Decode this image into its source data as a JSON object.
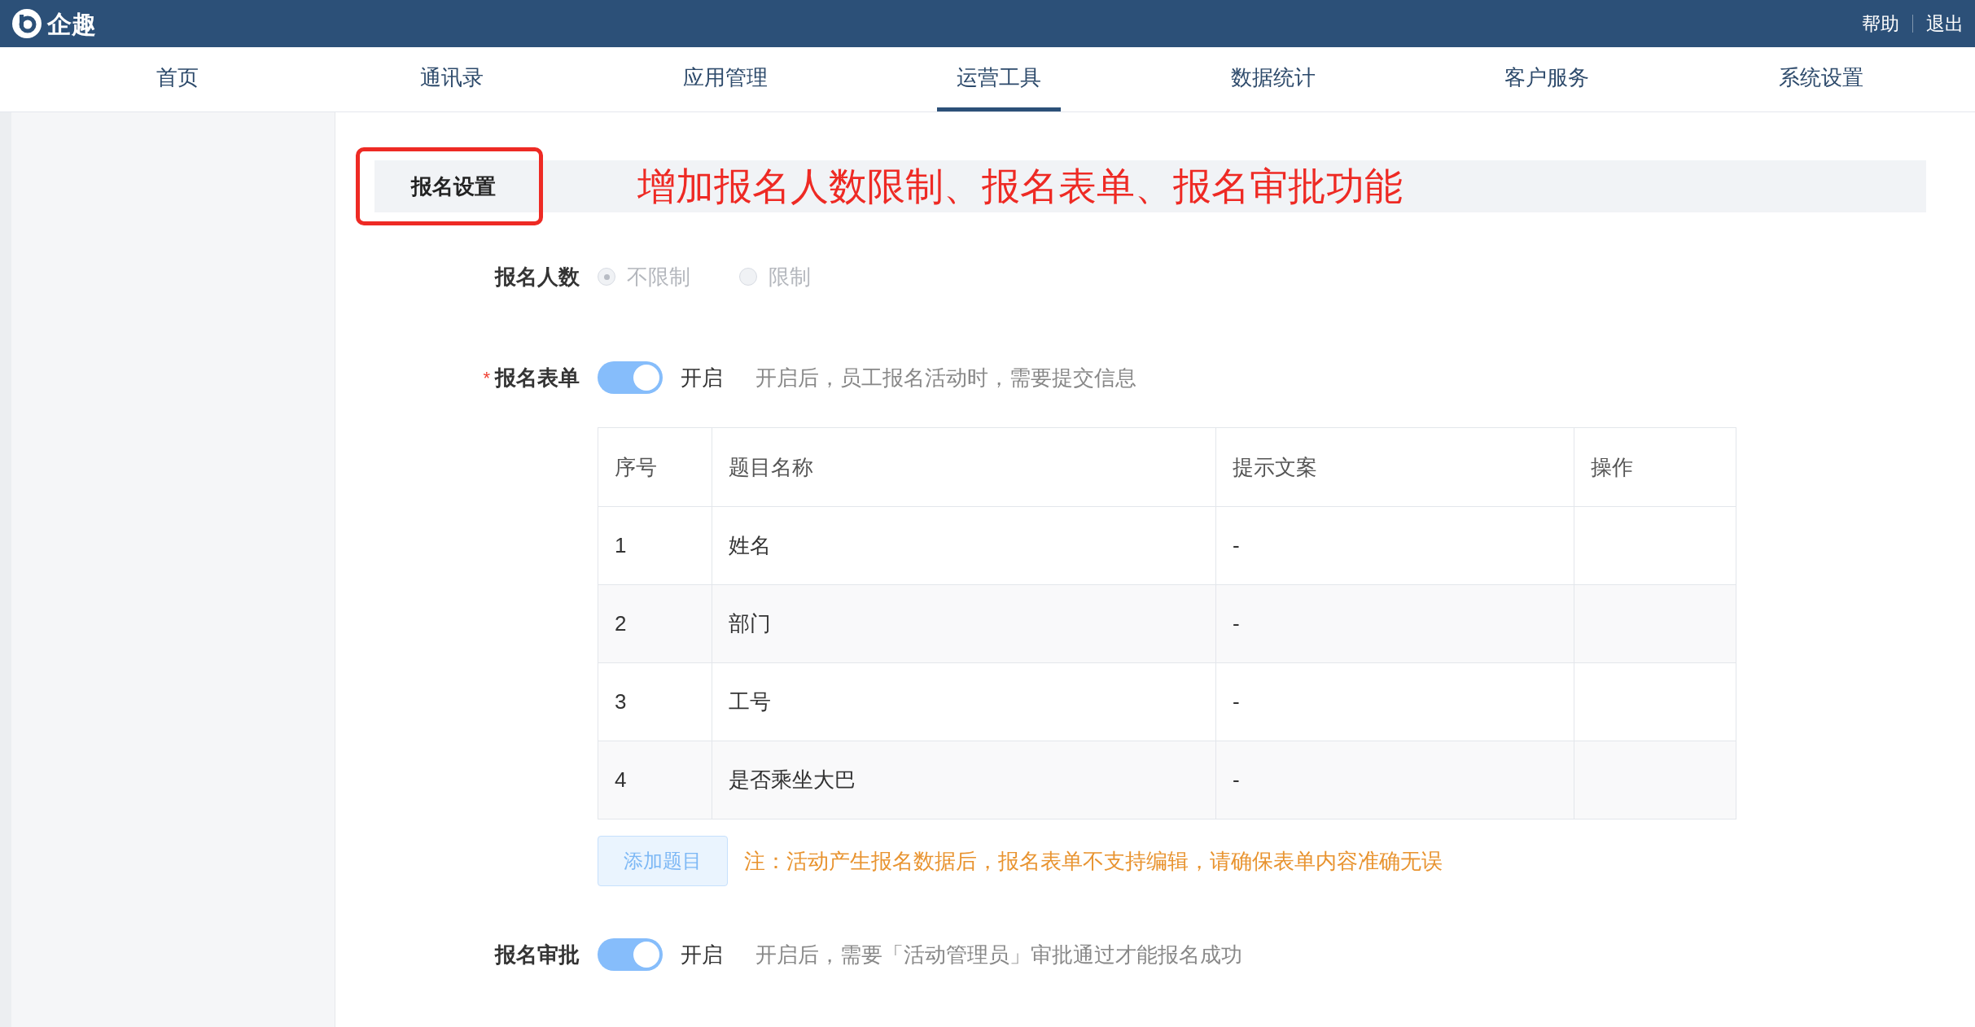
{
  "app": {
    "name": "企趣"
  },
  "header_links": [
    "帮助",
    "退出"
  ],
  "nav_tabs": [
    {
      "label": "首页",
      "selected": false
    },
    {
      "label": "通讯录",
      "selected": false
    },
    {
      "label": "应用管理",
      "selected": false
    },
    {
      "label": "运营工具",
      "selected": true
    },
    {
      "label": "数据统计",
      "selected": false
    },
    {
      "label": "客户服务",
      "selected": false
    },
    {
      "label": "系统设置",
      "selected": false
    }
  ],
  "section": {
    "title": "报名设置",
    "annotation": "增加报名人数限制、报名表单、报名审批功能"
  },
  "signup_limit": {
    "label": "报名人数",
    "disabled": true,
    "options": [
      {
        "label": "不限制",
        "selected": true
      },
      {
        "label": "限制",
        "selected": false
      }
    ]
  },
  "signup_form": {
    "label": "报名表单",
    "required_mark": "*",
    "toggle": {
      "on": true,
      "label": "开启"
    },
    "hint": "开启后，员工报名活动时，需要提交信息",
    "table": {
      "columns": [
        "序号",
        "题目名称",
        "提示文案",
        "操作"
      ],
      "rows": [
        [
          "1",
          "姓名",
          "-"
        ],
        [
          "2",
          "部门",
          "-"
        ],
        [
          "3",
          "工号",
          "-"
        ],
        [
          "4",
          "是否乘坐大巴",
          "-"
        ]
      ]
    },
    "add_button": "添加题目",
    "note": "注：活动产生报名数据后，报名表单不支持编辑，请确保表单内容准确无误"
  },
  "signup_approval": {
    "label": "报名审批",
    "toggle": {
      "on": true,
      "label": "开启"
    },
    "hint": "开启后，需要「活动管理员」审批通过才能报名成功"
  }
}
